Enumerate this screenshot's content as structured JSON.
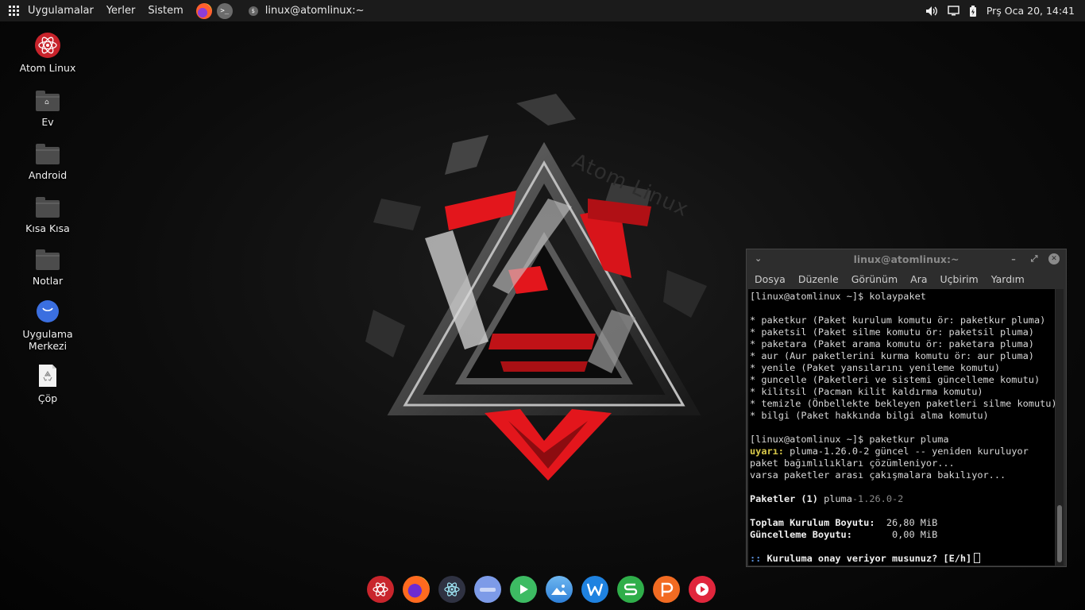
{
  "top_panel": {
    "menus": [
      "Uygulamalar",
      "Yerler",
      "Sistem"
    ],
    "task_title": "linux@atomlinux:~",
    "clock": "Prş Oca 20, 14:41",
    "icons": [
      "apps-grid-icon",
      "firefox-icon",
      "terminal-icon",
      "volume-icon",
      "display-icon",
      "battery-icon"
    ]
  },
  "desktop_icons": [
    {
      "label": "Atom Linux",
      "icon": "atom-logo-icon"
    },
    {
      "label": "Ev",
      "icon": "home-folder-icon"
    },
    {
      "label": "Android",
      "icon": "folder-icon"
    },
    {
      "label": "Kısa Kısa",
      "icon": "folder-icon"
    },
    {
      "label": "Notlar",
      "icon": "folder-icon"
    },
    {
      "label": "Uygulama\nMerkezi",
      "icon": "app-center-icon"
    },
    {
      "label": "Çöp",
      "icon": "trash-icon"
    }
  ],
  "wallpaper": {
    "watermark": "Atom Linux"
  },
  "terminal": {
    "title": "linux@atomlinux:~",
    "menu": [
      "Dosya",
      "Düzenle",
      "Görünüm",
      "Ara",
      "Uçbirim",
      "Yardım"
    ],
    "lines": [
      "[linux@atomlinux ~]$ kolaypaket",
      "",
      "* paketkur (Paket kurulum komutu ör: paketkur pluma)",
      "* paketsil (Paket silme komutu ör: paketsil pluma)",
      "* paketara (Paket arama komutu ör: paketara pluma)",
      "* aur (Aur paketlerini kurma komutu ör: aur pluma)",
      "* yenile (Paket yansılarını yenileme komutu)",
      "* guncelle (Paketleri ve sistemi güncelleme komutu)",
      "* kilitsil (Pacman kilit kaldırma komutu)",
      "* temizle (Önbellekte bekleyen paketleri silme komutu)",
      "* bilgi (Paket hakkında bilgi alma komutu)",
      "",
      "[linux@atomlinux ~]$ paketkur pluma",
      "pluma-1.26.0-2 güncel -- yeniden kuruluyor",
      "paket bağımlılıkları çözümleniyor...",
      "varsa paketler arası çakışmalara bakılıyor...",
      "",
      "pluma",
      "",
      "26,80 MiB",
      "0,00 MiB",
      ""
    ],
    "warn_label": "uyarı:",
    "packages_label": "Paketler (1)",
    "package_version": "-1.26.0-2",
    "total_size_label": "Toplam Kurulum Boyutu:",
    "update_size_label": "Güncelleme Boyutu:",
    "prompt_marker": "::",
    "confirm_question": "Kuruluma onay veriyor musunuz? [E/h]"
  },
  "dock": {
    "apps": [
      {
        "icon": "atom-linux-icon",
        "color": "#c9252c"
      },
      {
        "icon": "firefox-icon",
        "color": "#ff6a1f"
      },
      {
        "icon": "electron-icon",
        "color": "#2f3242"
      },
      {
        "icon": "software-store-icon",
        "color": "#7d9be8"
      },
      {
        "icon": "play-store-icon",
        "color": "#3dbb63"
      },
      {
        "icon": "image-viewer-icon",
        "color": "#4a9fe8"
      },
      {
        "icon": "wps-writer-icon",
        "color": "#1f82e0"
      },
      {
        "icon": "wps-spreadsheet-icon",
        "color": "#2fae4a"
      },
      {
        "icon": "wps-presentation-icon",
        "color": "#f26b22"
      },
      {
        "icon": "media-player-icon",
        "color": "#e0263c"
      }
    ]
  }
}
